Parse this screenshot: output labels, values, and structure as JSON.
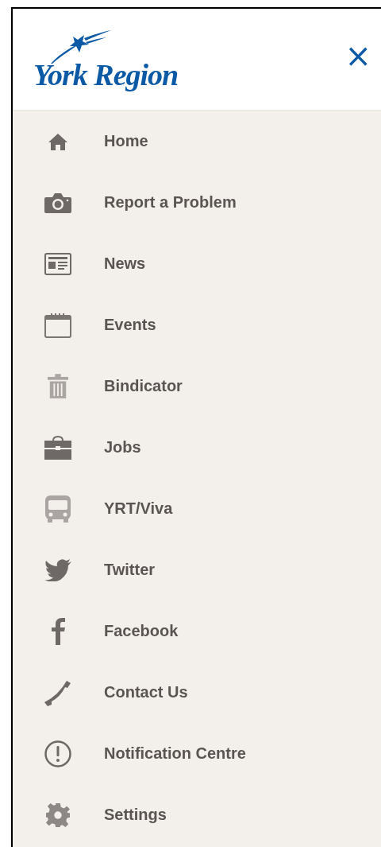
{
  "header": {
    "logo_text": "York Region",
    "close": "×"
  },
  "menu": [
    {
      "kind": "home",
      "label": "Home"
    },
    {
      "kind": "camera",
      "label": "Report a Problem"
    },
    {
      "kind": "news",
      "label": "News"
    },
    {
      "kind": "calendar",
      "label": "Events"
    },
    {
      "kind": "trash",
      "label": "Bindicator"
    },
    {
      "kind": "briefcase",
      "label": "Jobs"
    },
    {
      "kind": "bus",
      "label": "YRT/Viva"
    },
    {
      "kind": "bird",
      "label": "Twitter"
    },
    {
      "kind": "f",
      "label": "Facebook"
    },
    {
      "kind": "phone",
      "label": "Contact Us"
    },
    {
      "kind": "alert",
      "label": "Notification Centre"
    },
    {
      "kind": "gear",
      "label": "Settings"
    }
  ]
}
